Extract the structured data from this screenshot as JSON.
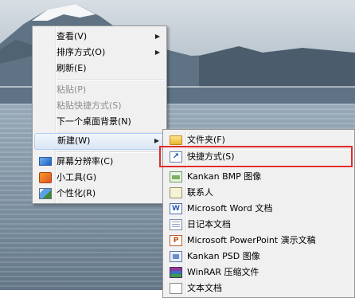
{
  "main_menu": {
    "items": [
      {
        "label": "查看(V)",
        "arrow": "▶"
      },
      {
        "label": "排序方式(O)",
        "arrow": "▶"
      },
      {
        "label": "刷新(E)"
      },
      {
        "label": "粘贴(P)"
      },
      {
        "label": "粘贴快捷方式(S)"
      },
      {
        "label": "下一个桌面背景(N)"
      },
      {
        "label": "新建(W)",
        "arrow": "▶"
      },
      {
        "label": "屏幕分辨率(C)",
        "icon": "monitor-icon"
      },
      {
        "label": "小工具(G)",
        "icon": "gadget-icon"
      },
      {
        "label": "个性化(R)",
        "icon": "personalize-icon"
      }
    ]
  },
  "new_submenu": {
    "items": [
      {
        "label": "文件夹(F)",
        "icon": "folder-icon"
      },
      {
        "label": "快捷方式(S)",
        "icon": "shortcut-icon"
      },
      {
        "label": "Kankan BMP 图像",
        "icon": "bmp-image-icon"
      },
      {
        "label": "联系人",
        "icon": "contact-icon"
      },
      {
        "label": "Microsoft Word 文档",
        "icon": "word-icon"
      },
      {
        "label": "日记本文档",
        "icon": "journal-icon"
      },
      {
        "label": "Microsoft PowerPoint 演示文稿",
        "icon": "powerpoint-icon"
      },
      {
        "label": "Kankan PSD 图像",
        "icon": "psd-image-icon"
      },
      {
        "label": "WinRAR 压缩文件",
        "icon": "winrar-icon"
      },
      {
        "label": "文本文档",
        "icon": "text-document-icon"
      }
    ]
  },
  "colors": {
    "highlight_box": "#e02b2b",
    "hover_border": "#aecff7"
  }
}
